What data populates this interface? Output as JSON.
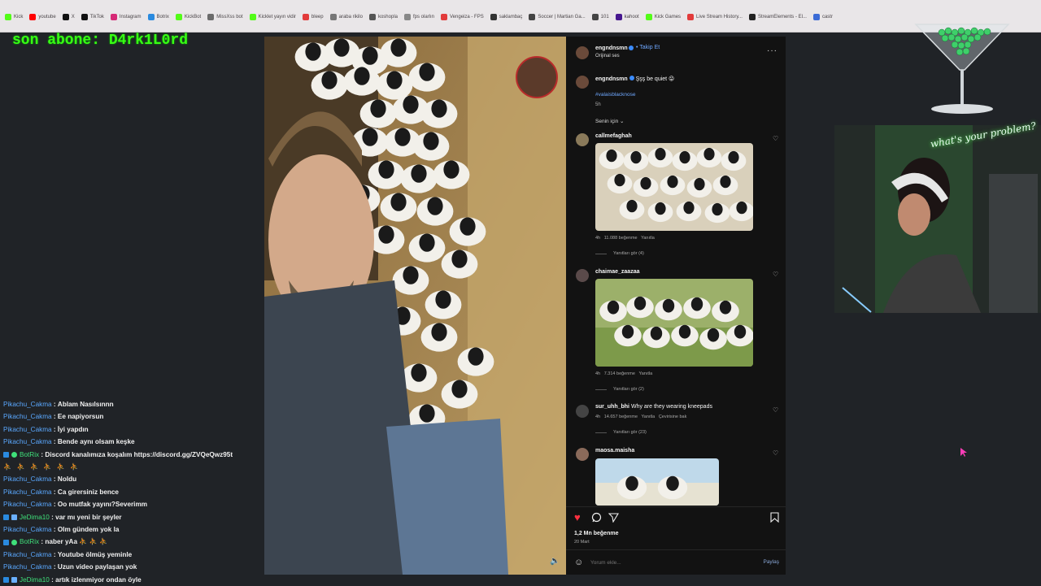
{
  "bookmarks": [
    {
      "label": "Kick",
      "color": "#53fc18"
    },
    {
      "label": "youtube",
      "color": "#ff0000"
    },
    {
      "label": "X",
      "color": "#111111"
    },
    {
      "label": "TikTok",
      "color": "#111111"
    },
    {
      "label": "Instagram",
      "color": "#d62976"
    },
    {
      "label": "Botrix",
      "color": "#2a8adf"
    },
    {
      "label": "KickBot",
      "color": "#53fc18"
    },
    {
      "label": "MissXss bot",
      "color": "#6b6b6b"
    },
    {
      "label": "Kicklet yayın vidir",
      "color": "#53fc18"
    },
    {
      "label": "bleep",
      "color": "#e23b3b"
    },
    {
      "label": "araba rikilo",
      "color": "#777777"
    },
    {
      "label": "koshopla",
      "color": "#555555"
    },
    {
      "label": "fps olarlın",
      "color": "#888888"
    },
    {
      "label": "Vengeiza - FPS",
      "color": "#e23b3b"
    },
    {
      "label": "saklambaç",
      "color": "#333333"
    },
    {
      "label": "Soccer | Martian Ga...",
      "color": "#444444"
    },
    {
      "label": "101",
      "color": "#444444"
    },
    {
      "label": "kahoot",
      "color": "#46178f"
    },
    {
      "label": "Kick Games",
      "color": "#53fc18"
    },
    {
      "label": "Live Stream History...",
      "color": "#e23b3b"
    },
    {
      "label": "StreamElements - El...",
      "color": "#222222"
    },
    {
      "label": "castr",
      "color": "#3b6bd6"
    }
  ],
  "overlay": {
    "last_sub": "son abone: D4rk1L0rd"
  },
  "chat": [
    {
      "user": "Pikachu_Cakma",
      "user_color": "#5aa8ff",
      "text": "Ablam Nasılsınnn",
      "badges": []
    },
    {
      "user": "Pikachu_Cakma",
      "user_color": "#5aa8ff",
      "text": "Ee napiyorsun",
      "badges": []
    },
    {
      "user": "Pikachu_Cakma",
      "user_color": "#5aa8ff",
      "text": "İyi yapdın",
      "badges": []
    },
    {
      "user": "Pikachu_Cakma",
      "user_color": "#5aa8ff",
      "text": "Bende aynı olsam keşke",
      "badges": []
    },
    {
      "user": "BotRix",
      "user_color": "#3fe07a",
      "text": "Discord kanalımıza koşalım https://discord.gg/ZVQeQwz95t",
      "badges": [
        "bot",
        "live"
      ]
    },
    {
      "emotes": "⛹ ⛹ ⛹ ⛹ ⛹ ⛹"
    },
    {
      "user": "Pikachu_Cakma",
      "user_color": "#5aa8ff",
      "text": "Noldu",
      "badges": []
    },
    {
      "user": "Pikachu_Cakma",
      "user_color": "#5aa8ff",
      "text": "Ca girersiniz bence",
      "badges": []
    },
    {
      "user": "Pikachu_Cakma",
      "user_color": "#5aa8ff",
      "text": "Oo mutfak yayını?Severimm",
      "badges": []
    },
    {
      "user": "JeDima10",
      "user_color": "#3fe07a",
      "text": "var mı yeni bir şeyler",
      "badges": [
        "bot",
        "dev"
      ]
    },
    {
      "user": "Pikachu_Cakma",
      "user_color": "#5aa8ff",
      "text": "Olm gündem yok la",
      "badges": []
    },
    {
      "user": "BotRix",
      "user_color": "#3fe07a",
      "text": "naber yAa ⛹ ⛹ ⛹",
      "badges": [
        "bot",
        "live"
      ]
    },
    {
      "user": "Pikachu_Cakma",
      "user_color": "#5aa8ff",
      "text": "Youtube ölmüş yeminle",
      "badges": []
    },
    {
      "user": "Pikachu_Cakma",
      "user_color": "#5aa8ff",
      "text": "Uzun video paylaşan yok",
      "badges": []
    },
    {
      "user": "JeDima10",
      "user_color": "#3fe07a",
      "text": "artık izlenmiyor ondan öyle",
      "badges": [
        "bot",
        "dev"
      ]
    }
  ],
  "post": {
    "author": "engndnsmn",
    "follow": "Takip Et",
    "audio": "Orijinal ses",
    "more_icon": "more-icon",
    "caption": "Şşş be quiet 😜",
    "hashtag": "#valaisblacknose",
    "time": "5h",
    "sort": "Senin için",
    "likes": "1,2 Mn beğenme",
    "date": "20 Mart",
    "comment_placeholder": "Yorum ekle...",
    "share": "Paylaş"
  },
  "comments": [
    {
      "user": "callmefaghah",
      "text": "",
      "time": "4h",
      "likes": "11.088 beğenme",
      "reply": "Yanıtla",
      "translate": "",
      "view_replies": "Yanıtları gör (4)"
    },
    {
      "user": "chaimae_zaazaa",
      "text": "",
      "time": "4h",
      "likes": "7.314 beğenme",
      "reply": "Yanıtla",
      "translate": "",
      "view_replies": "Yanıtları gör (2)"
    },
    {
      "user": "sur_uhh_bhi",
      "text": "Why are they wearing kneepads",
      "time": "4h",
      "likes": "14.657 beğenme",
      "reply": "Yanıtla",
      "translate": "Çevirisine bak",
      "view_replies": "Yanıtları gör (23)"
    },
    {
      "user": "maosa.maisha",
      "text": "",
      "time": "",
      "likes": "",
      "reply": "",
      "translate": "",
      "view_replies": ""
    }
  ],
  "webcam": {
    "neon_sign": "what's your problem?"
  },
  "colors": {
    "accent_green": "#39ff14",
    "ig_bg": "#121212",
    "page_bg": "#202327",
    "like_red": "#ff3040",
    "link_blue": "#6fa8ff"
  }
}
